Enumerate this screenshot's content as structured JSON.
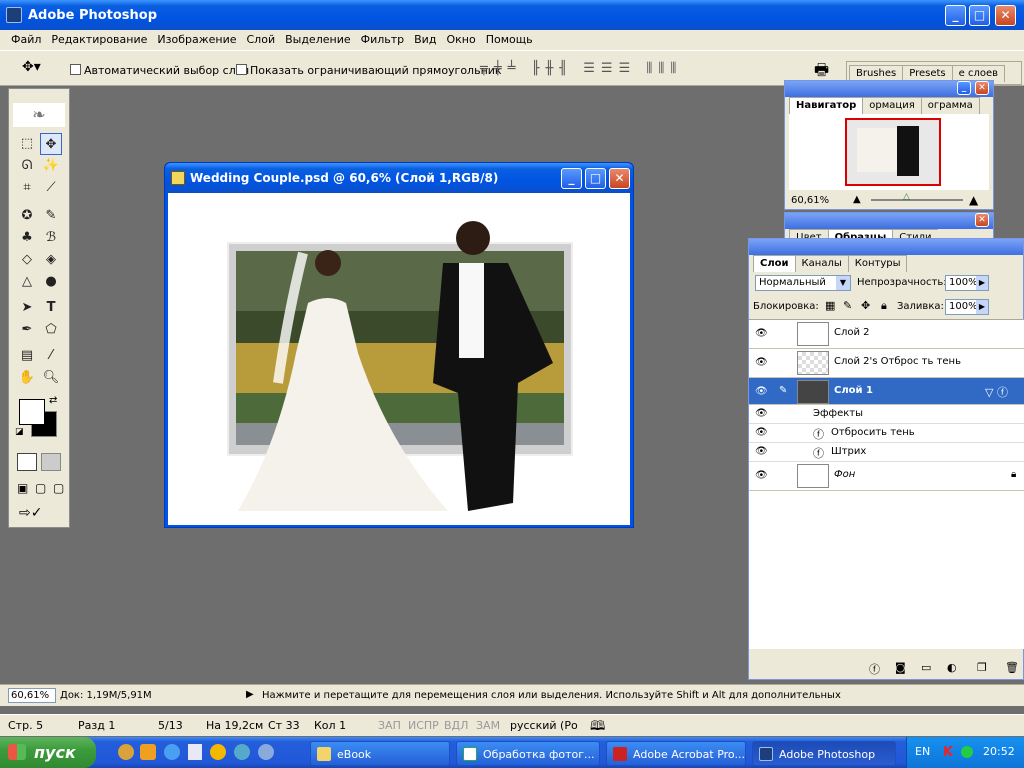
{
  "app": {
    "title": "Adobe Photoshop"
  },
  "menu": [
    "Файл",
    "Редактирование",
    "Изображение",
    "Слой",
    "Выделение",
    "Фильтр",
    "Вид",
    "Окно",
    "Помощь"
  ],
  "options": {
    "auto_select": "Автоматический выбор слоя",
    "show_bounds": "Показать ограничивающий прямоугольник",
    "well_tabs": [
      "Brushes",
      "Presets",
      "е слоев"
    ]
  },
  "document": {
    "title": "Wedding Couple.psd @ 60,6% (Слой 1,RGB/8)"
  },
  "navigator": {
    "tabs": [
      "Навигатор",
      "ормация",
      "ограмма"
    ],
    "zoom": "60,61%"
  },
  "color_palette": {
    "tabs": [
      "Цвет",
      "Образцы",
      "Стили"
    ]
  },
  "layers": {
    "tabs": [
      "Слои",
      "Каналы",
      "Контуры"
    ],
    "blend_mode": "Нормальный",
    "opacity_label": "Непрозрачность:",
    "opacity": "100%",
    "lock_label": "Блокировка:",
    "fill_label": "Заливка:",
    "fill": "100%",
    "rows": [
      {
        "name": "Слой 2"
      },
      {
        "name": "Слой 2's Отброс ть тень"
      },
      {
        "name": "Слой 1"
      },
      {
        "name": "Эффекты"
      },
      {
        "name": "Отбросить тень"
      },
      {
        "name": "Штрих"
      },
      {
        "name": "Фон"
      }
    ]
  },
  "status": {
    "zoom": "60,61%",
    "doc": "Док: 1,19M/5,91M",
    "hint": "Нажмите и перетащите для перемещения слоя или выделения. Используйте Shift и Alt для дополнительных"
  },
  "word_status": {
    "page": "Стр. 5",
    "section": "Разд 1",
    "pages": "5/13",
    "at": "На 19,2см",
    "line": "Ст 33",
    "col": "Кол 1",
    "rec": "ЗАП",
    "trk": "ИСПР",
    "ext": "ВДЛ",
    "ovr": "ЗАМ",
    "lang": "русский (Ро"
  },
  "taskbar": {
    "start": "пуск",
    "items": [
      "eBook",
      "Обработка фотог...",
      "Adobe Acrobat Pro...",
      "Adobe Photoshop"
    ],
    "lang": "EN",
    "time": "20:52"
  },
  "colors": {
    "accent": "#316ac5",
    "xp_blue": "#0054e3",
    "start_green": "#3c9c3c"
  }
}
